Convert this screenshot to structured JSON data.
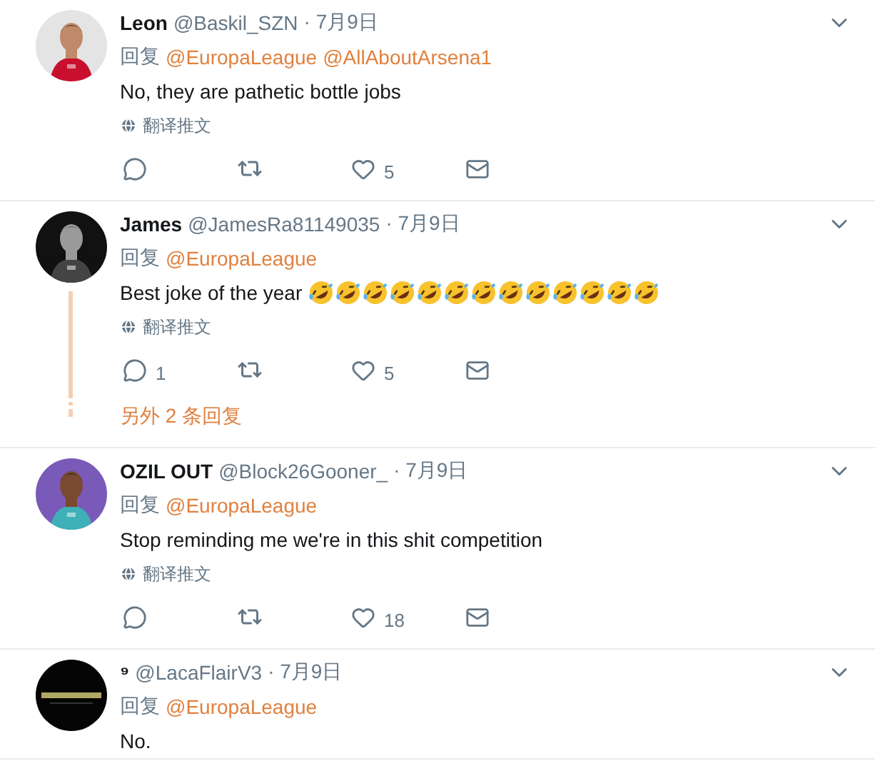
{
  "tweets": [
    {
      "avatar": {
        "kind": "picture"
      },
      "name": "Leon",
      "handle": "@Baskil_SZN",
      "date": "· 7月9日",
      "reply_prefix": "回复",
      "mentions": [
        "@EuropaLeague",
        "@AllAboutArsena1"
      ],
      "text": "No, they are pathetic bottle jobs",
      "translate": "翻译推文",
      "actions": {
        "likes": "5"
      }
    },
    {
      "avatar": {
        "kind": "picture"
      },
      "name": "James",
      "handle": "@JamesRa81149035",
      "date": "· 7月9日",
      "reply_prefix": "回复",
      "mentions": [
        "@EuropaLeague"
      ],
      "text": "Best joke of the year",
      "emojis": [
        {
          "kind": "rofl"
        },
        {
          "kind": "rofl"
        },
        {
          "kind": "rofl"
        },
        {
          "kind": "rofl"
        },
        {
          "kind": "rofl"
        },
        {
          "kind": "rofl"
        },
        {
          "kind": "rofl"
        },
        {
          "kind": "rofl"
        },
        {
          "kind": "rofl"
        },
        {
          "kind": "rofl"
        },
        {
          "kind": "rofl"
        },
        {
          "kind": "rofl"
        },
        {
          "kind": "rofl"
        }
      ],
      "translate": "翻译推文",
      "actions": {
        "replies": "1",
        "likes": "5"
      },
      "more_replies": "另外 2 条回复"
    },
    {
      "avatar": {
        "kind": "picture"
      },
      "name": "OZIL OUT",
      "handle": "@Block26Gooner_",
      "date": "· 7月9日",
      "reply_prefix": "回复",
      "mentions": [
        "@EuropaLeague"
      ],
      "text": "Stop reminding me we're in this shit competition",
      "translate": "翻译推文",
      "actions": {
        "likes": "18"
      }
    },
    {
      "avatar": {
        "kind": "picture"
      },
      "name": "⁹",
      "handle": "@LacaFlairV3",
      "date": "· 7月9日",
      "reply_prefix": "回复",
      "mentions": [
        "@EuropaLeague"
      ],
      "text": "No."
    }
  ]
}
